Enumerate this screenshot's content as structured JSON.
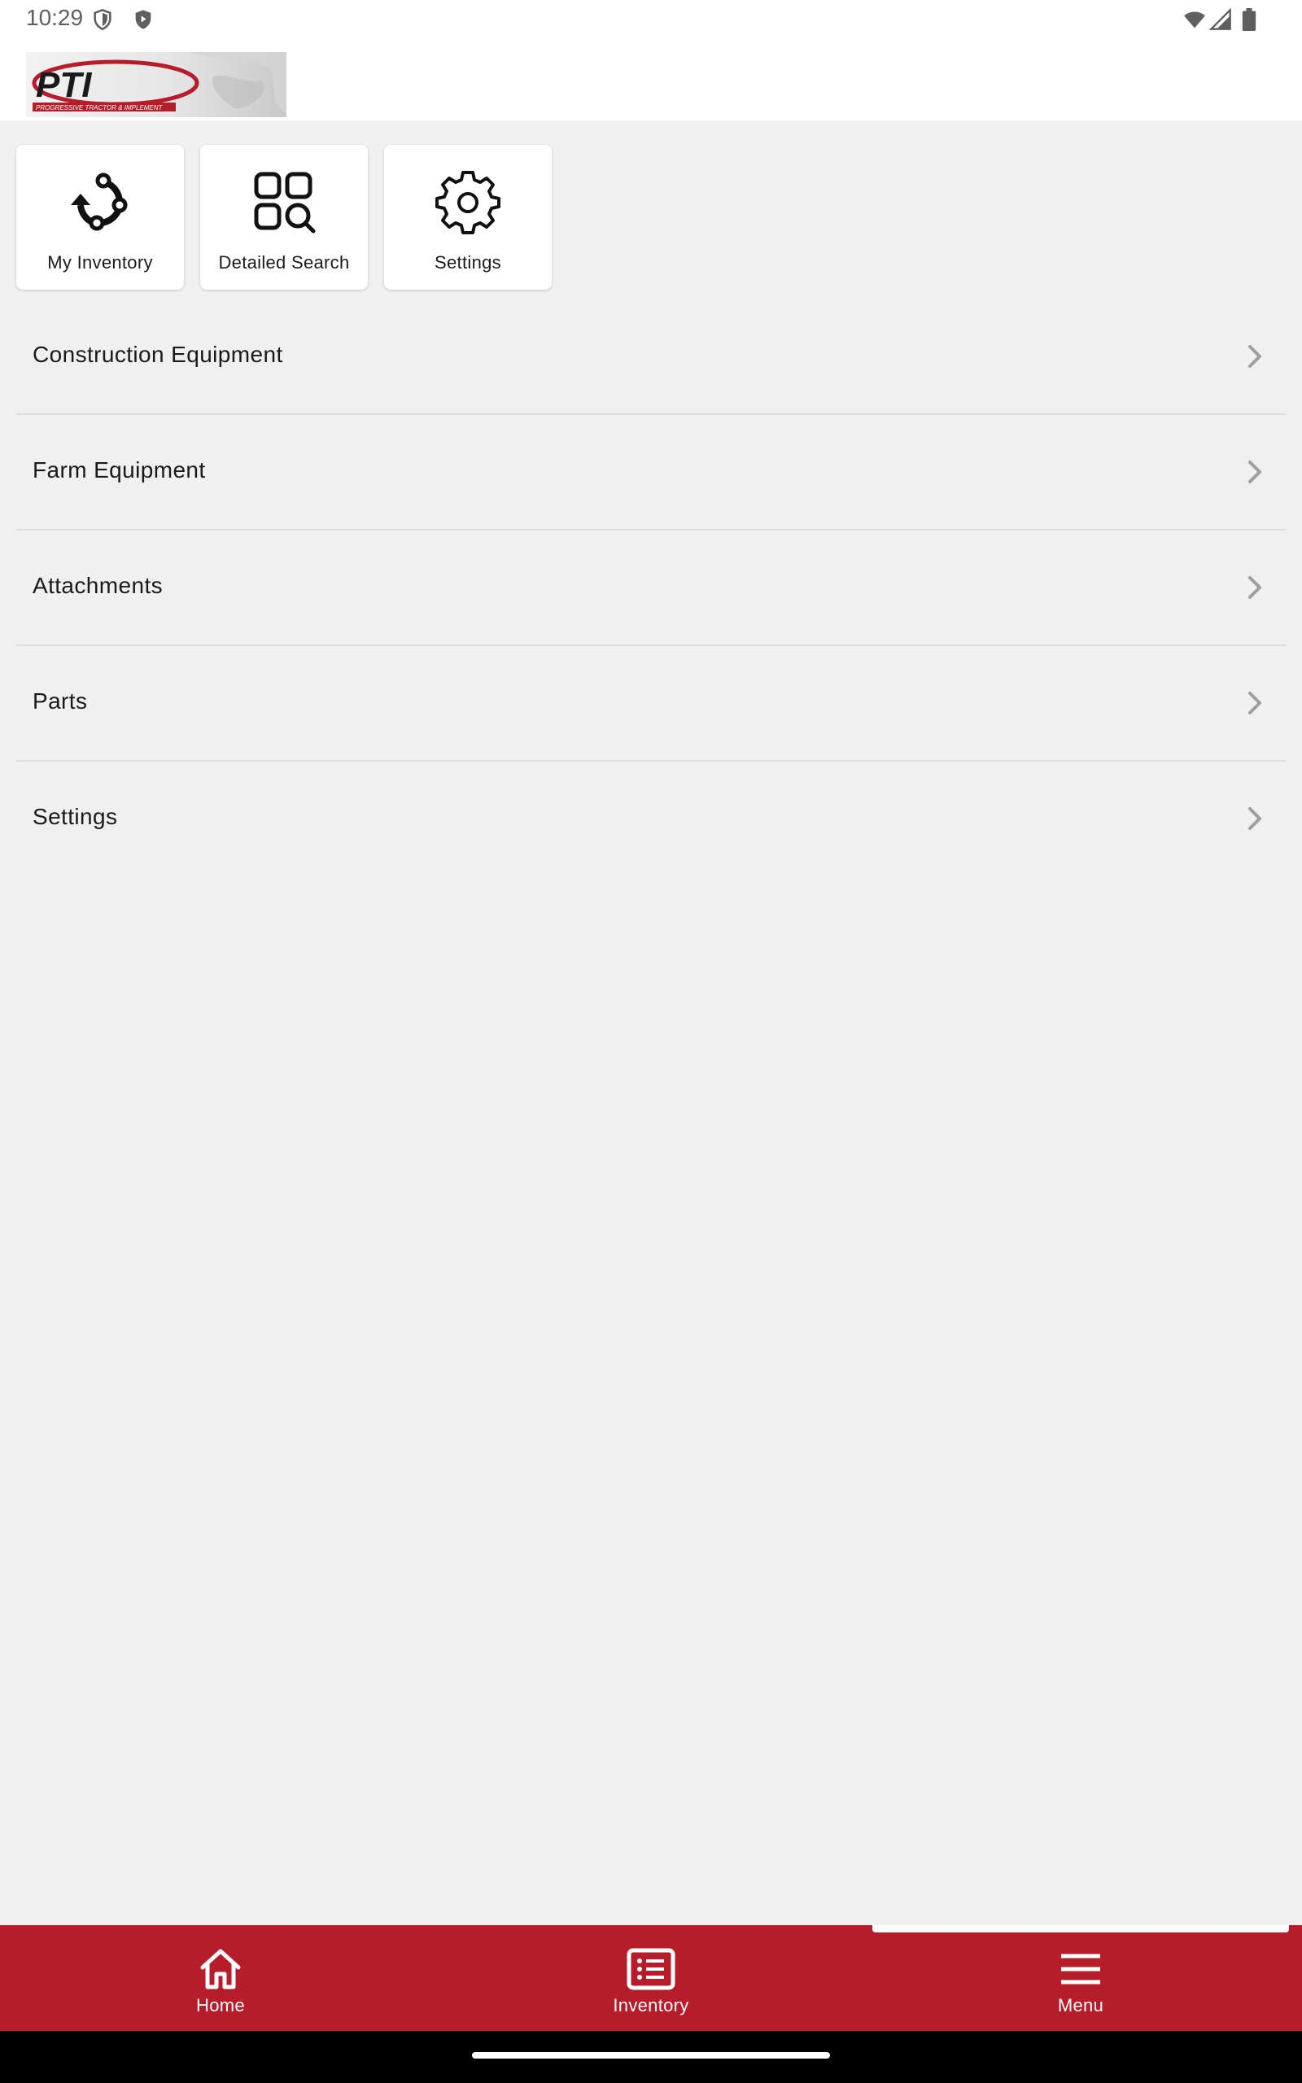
{
  "status_bar": {
    "time": "10:29",
    "left_icons": [
      "shield-icon",
      "play-protect-icon"
    ],
    "right_icons": [
      "wifi-icon",
      "signal-icon",
      "battery-icon"
    ]
  },
  "header": {
    "logo_text": "PTI",
    "logo_tagline": "PROGRESSIVE TRACTOR & IMPLEMENT"
  },
  "tiles": [
    {
      "label": "My Inventory",
      "icon": "inventory-cycle-icon"
    },
    {
      "label": "Detailed Search",
      "icon": "grid-search-icon"
    },
    {
      "label": "Settings",
      "icon": "gear-icon"
    }
  ],
  "categories": [
    {
      "label": "Construction Equipment"
    },
    {
      "label": "Farm Equipment"
    },
    {
      "label": "Attachments"
    },
    {
      "label": "Parts"
    },
    {
      "label": "Settings"
    }
  ],
  "bottom_nav": {
    "items": [
      {
        "label": "Home",
        "icon": "home-icon"
      },
      {
        "label": "Inventory",
        "icon": "list-icon"
      },
      {
        "label": "Menu",
        "icon": "menu-icon"
      }
    ],
    "active": "Menu"
  },
  "colors": {
    "brand": "#b71c2a",
    "background": "#f0f0f0",
    "surface": "#ffffff",
    "divider": "#dcdcdc",
    "chevron": "#9e9e9e"
  }
}
